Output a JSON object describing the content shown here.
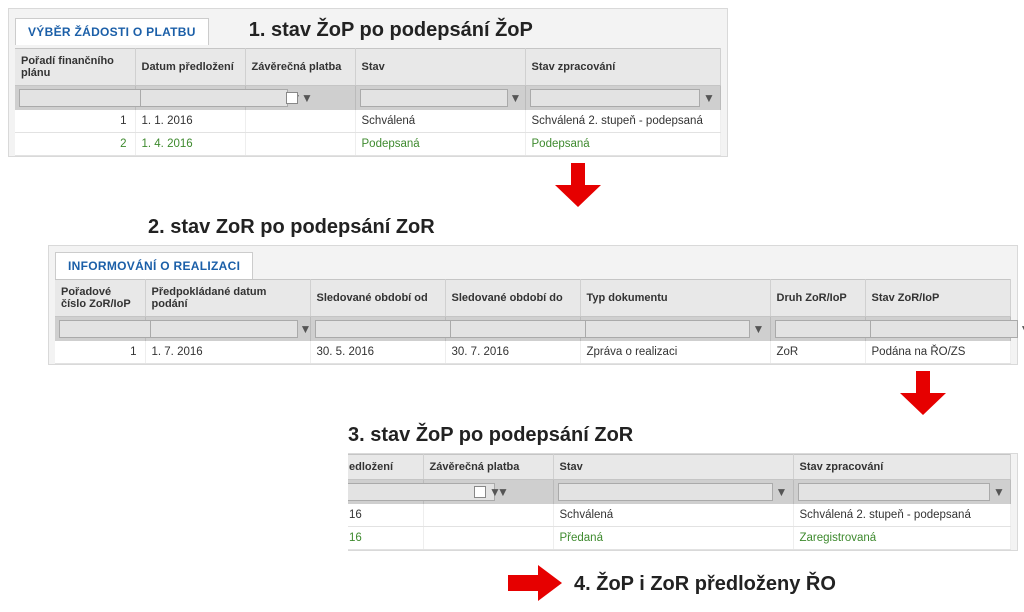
{
  "section1": {
    "heading": "1. stav ŽoP po podepsání ŽoP",
    "tabLabel": "VÝBĚR ŽÁDOSTI O PLATBU",
    "headers": {
      "poradi": "Pořadí finančního plánu",
      "datum": "Datum předložení",
      "zaverecna": "Závěrečná platba",
      "stav": "Stav",
      "stavZprac": "Stav zpracování"
    },
    "rows": [
      {
        "poradi": "1",
        "datum": "1. 1. 2016",
        "stav": "Schválená",
        "stavZprac": "Schválená 2. stupeň - podepsaná",
        "green": false
      },
      {
        "poradi": "2",
        "datum": "1. 4. 2016",
        "stav": "Podepsaná",
        "stavZprac": "Podepsaná",
        "green": true
      }
    ]
  },
  "section2": {
    "heading": "2. stav ZoR po podepsání ZoR",
    "tabLabel": "INFORMOVÁNÍ O REALIZACI",
    "headers": {
      "poradove": "Pořadové číslo ZoR/IoP",
      "predpokladane": "Předpokládané datum podání",
      "sledOd": "Sledované období od",
      "sledDo": "Sledované období do",
      "typDok": "Typ dokumentu",
      "druh": "Druh ZoR/IoP",
      "stav": "Stav ZoR/IoP"
    },
    "rows": [
      {
        "poradove": "1",
        "predpokladane": "1. 7. 2016",
        "sledOd": "30. 5. 2016",
        "sledDo": "30. 7. 2016",
        "typDok": "Zpráva o realizaci",
        "druh": "ZoR",
        "stav": "Podána na ŘO/ZS"
      }
    ]
  },
  "section3": {
    "heading": "3. stav ŽoP po podepsání ZoR",
    "headers": {
      "predlozeni": "edložení",
      "zaverecna": "Závěrečná platba",
      "stav": "Stav",
      "stavZprac": "Stav zpracování"
    },
    "rows": [
      {
        "predlozeni": "16",
        "stav": "Schválená",
        "stavZprac": "Schválená 2. stupeň - podepsaná",
        "green": false
      },
      {
        "predlozeni": "16",
        "stav": "Předaná",
        "stavZprac": "Zaregistrovaná",
        "green": true
      }
    ]
  },
  "section4": {
    "heading": "4. ŽoP i ZoR předloženy ŘO"
  },
  "colors": {
    "arrow": "#e60000",
    "tabText": "#1b5fa8",
    "green": "#3e8a2e"
  }
}
